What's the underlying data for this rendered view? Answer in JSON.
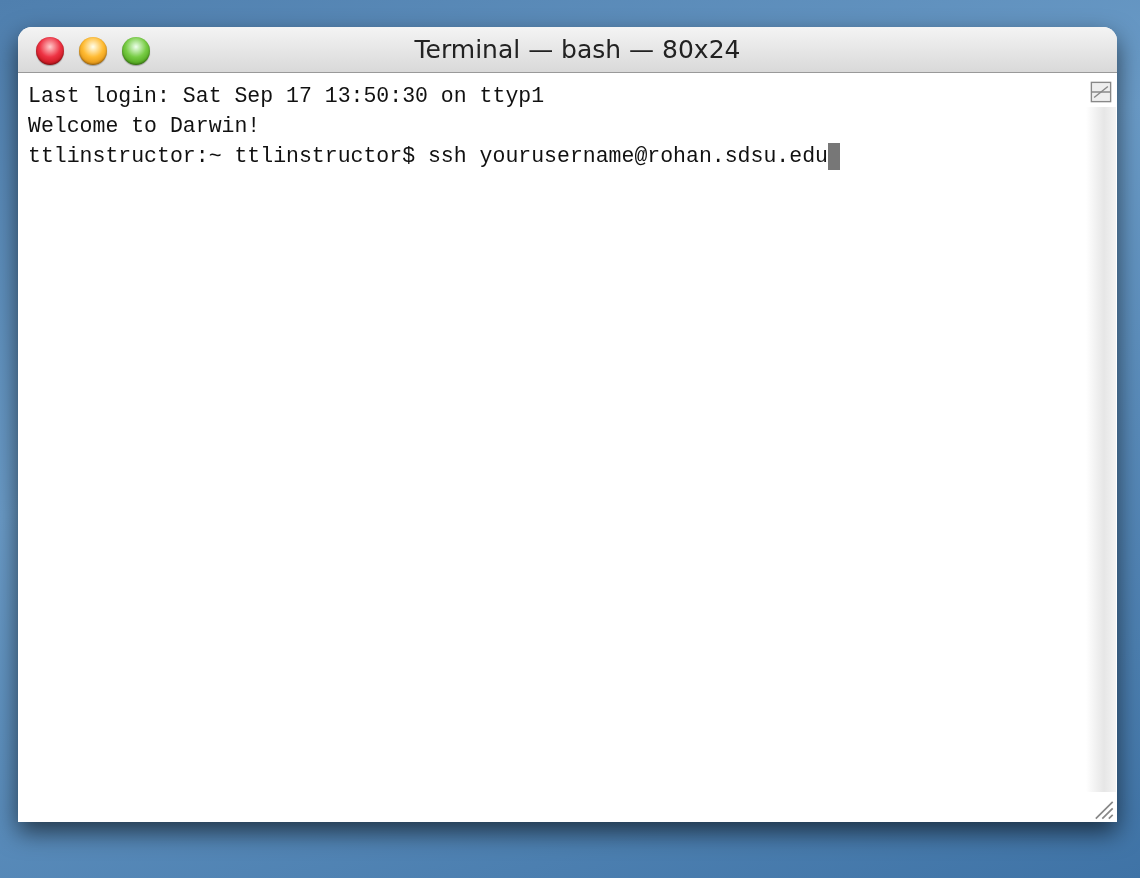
{
  "window": {
    "title": "Terminal — bash — 80x24"
  },
  "terminal": {
    "lines": [
      {
        "text": "Last login: Sat Sep 17 13:50:30 on ttyp1",
        "cursor": false
      },
      {
        "text": "Welcome to Darwin!",
        "cursor": false
      },
      {
        "text": "ttlinstructor:~ ttlinstructor$ ssh yourusername@rohan.sdsu.edu",
        "cursor": true
      }
    ]
  }
}
